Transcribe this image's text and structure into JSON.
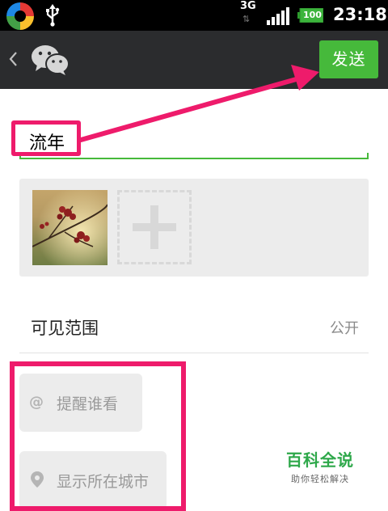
{
  "status_bar": {
    "network": "3G",
    "battery": "100",
    "time": "23:18"
  },
  "header": {
    "send_label": "发送"
  },
  "post": {
    "text": "流年"
  },
  "visibility": {
    "label": "可见范围",
    "value": "公开"
  },
  "options": {
    "remind_label": "提醒谁看",
    "location_label": "显示所在城市"
  },
  "watermark": {
    "title": "百科全说",
    "subtitle": "助你轻松解决"
  },
  "colors": {
    "accent_green": "#46b93b",
    "annotation_pink": "#ee1b6b",
    "titlebar": "#2b2c2e"
  }
}
